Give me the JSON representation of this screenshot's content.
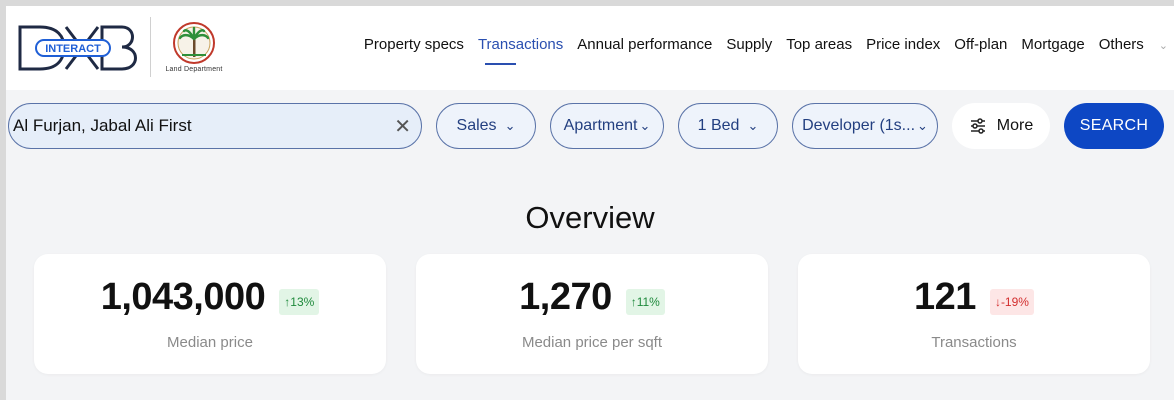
{
  "header": {
    "logo": {
      "brand": "DXB",
      "sub": "INTERACT",
      "partner": "Land Department"
    },
    "nav": [
      {
        "label": "Property specs"
      },
      {
        "label": "Transactions",
        "active": true
      },
      {
        "label": "Annual performance"
      },
      {
        "label": "Supply"
      },
      {
        "label": "Top areas"
      },
      {
        "label": "Price index"
      },
      {
        "label": "Off-plan"
      },
      {
        "label": "Mortgage"
      },
      {
        "label": "Others"
      }
    ]
  },
  "filters": {
    "location": {
      "value": "Al Furjan, Jabal Ali First",
      "clear_icon": "close-icon"
    },
    "transaction_type": {
      "label": "Sales"
    },
    "property_type": {
      "label": "Apartment"
    },
    "bedrooms": {
      "label": "1 Bed"
    },
    "developer": {
      "label": "Developer (1s..."
    },
    "more": {
      "label": "More",
      "icon": "sliders-icon"
    },
    "search": {
      "label": "SEARCH"
    }
  },
  "overview": {
    "title": "Overview",
    "cards": [
      {
        "value": "1,043,000",
        "change": "↑13%",
        "direction": "up",
        "label": "Median price"
      },
      {
        "value": "1,270",
        "change": "↑11%",
        "direction": "up",
        "label": "Median price per sqft"
      },
      {
        "value": "121",
        "change": "↓-19%",
        "direction": "down",
        "label": "Transactions"
      }
    ]
  },
  "colors": {
    "accent": "#0d47c4",
    "nav_active": "#2a4fb0",
    "up": "#1f8a3c",
    "down": "#d32f2f"
  }
}
